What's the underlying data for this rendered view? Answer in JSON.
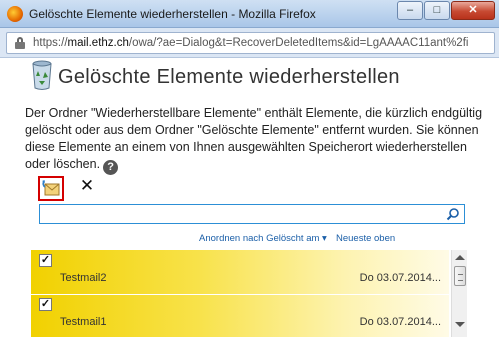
{
  "window": {
    "title": "Gelöschte Elemente wiederherstellen - Mozilla Firefox",
    "min_label": "–",
    "max_label": "□",
    "close_label": "✕"
  },
  "address_bar": {
    "scheme": "https://",
    "host": "mail.ethz.ch",
    "path": "/owa/?ae=Dialog&t=RecoverDeletedItems&id=LgAAAAC11ant%2fi"
  },
  "page": {
    "heading": "Gelöschte Elemente wiederherstellen",
    "description": "Der Ordner \"Wiederherstellbare Elemente\" enthält Elemente, die kürzlich endgültig gelöscht oder aus dem Ordner \"Gelöschte Elemente\" entfernt wurden. Sie können diese Elemente an einem von Ihnen ausgewählten Speicherort wiederherstellen oder löschen.",
    "help_label": "?"
  },
  "toolbar": {
    "delete_label": "✕"
  },
  "search": {
    "value": ""
  },
  "sort": {
    "by_label": "Anordnen nach Gelöscht am ▾",
    "order_label": "Neueste oben"
  },
  "items": [
    {
      "subject": "Testmail2",
      "date": "Do 03.07.2014...",
      "checked": "✓"
    },
    {
      "subject": "Testmail1",
      "date": "Do 03.07.2014...",
      "checked": "✓"
    }
  ],
  "colors": {
    "row_highlight": "#f1d100",
    "focus_border": "#2c8fd6",
    "selected_tool_border": "#d40000",
    "link": "#1b5fa8"
  },
  "icons": [
    "firefox-icon",
    "lock-icon",
    "recycle-bin-icon",
    "help-icon",
    "restore-icon",
    "delete-icon",
    "search-icon"
  ]
}
